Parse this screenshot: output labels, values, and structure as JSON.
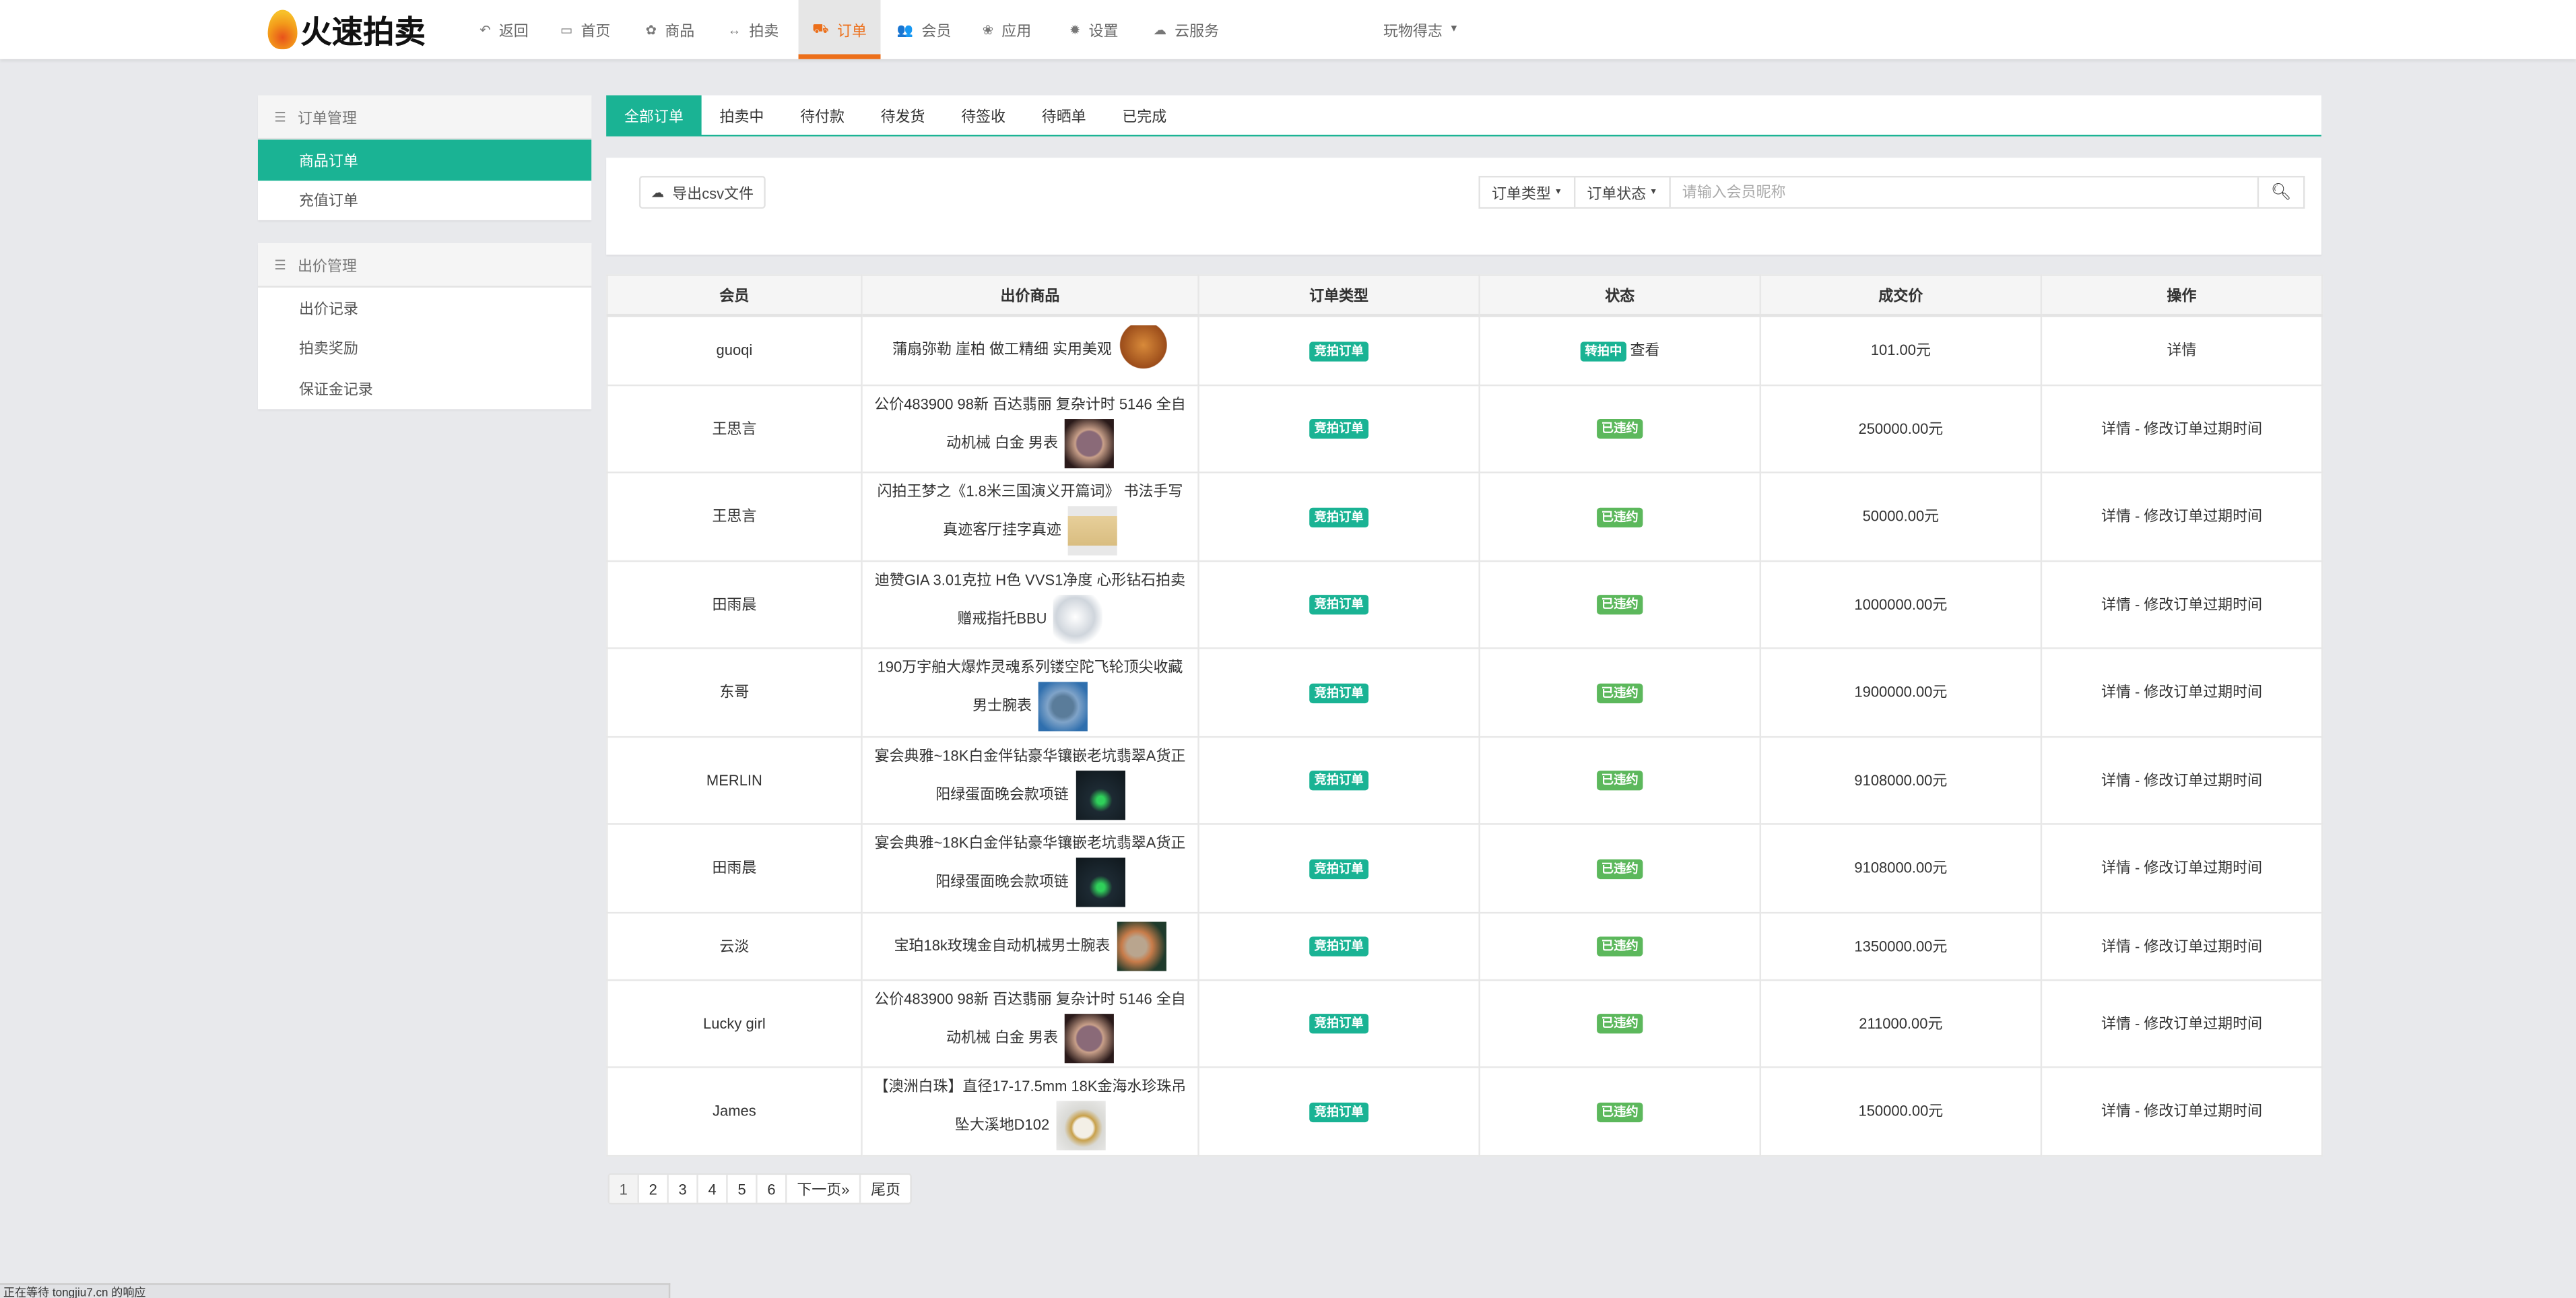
{
  "header": {
    "logo_text": "火速拍卖",
    "nav": [
      {
        "label": "返回",
        "icon": "reply-icon"
      },
      {
        "label": "首页",
        "icon": "desktop-icon"
      },
      {
        "label": "商品",
        "icon": "gift-icon"
      },
      {
        "label": "拍卖",
        "icon": "arrows-h-icon"
      },
      {
        "label": "订单",
        "icon": "cart-icon",
        "active": true
      },
      {
        "label": "会员",
        "icon": "users-icon"
      },
      {
        "label": "应用",
        "icon": "apps-icon"
      },
      {
        "label": "设置",
        "icon": "gear-icon"
      },
      {
        "label": "云服务",
        "icon": "cloud-icon"
      }
    ],
    "user": "玩物得志"
  },
  "sidebar": [
    {
      "title": "订单管理",
      "items": [
        {
          "label": "商品订单",
          "active": true
        },
        {
          "label": "充值订单"
        }
      ]
    },
    {
      "title": "出价管理",
      "items": [
        {
          "label": "出价记录"
        },
        {
          "label": "拍卖奖励"
        },
        {
          "label": "保证金记录"
        }
      ]
    }
  ],
  "tabs": [
    "全部订单",
    "拍卖中",
    "待付款",
    "待发货",
    "待签收",
    "待晒单",
    "已完成"
  ],
  "toolbar": {
    "export": "导出csv文件",
    "order_type": "订单类型",
    "order_status": "订单状态",
    "search_placeholder": "请输入会员昵称"
  },
  "table": {
    "headers": [
      "会员",
      "出价商品",
      "订单类型",
      "状态",
      "成交价",
      "操作"
    ],
    "rows": [
      {
        "member": "guoqi",
        "product": "蒲扇弥勒 崖柏 做工精细 实用美观",
        "type": "竞拍订单",
        "status": "转拍中",
        "status_link": "查看",
        "price": "101.00元",
        "actions": "详情"
      },
      {
        "member": "王思言",
        "product": "公价483900 98新 百达翡丽 复杂计时 5146 全自动机械 白金 男表",
        "type": "竞拍订单",
        "status": "已违约",
        "price": "250000.00元",
        "actions": "详情 - 修改订单过期时间"
      },
      {
        "member": "王思言",
        "product": "闪拍王梦之《1.8米三国演义开篇词》 书法手写真迹客厅挂字真迹",
        "type": "竞拍订单",
        "status": "已违约",
        "price": "50000.00元",
        "actions": "详情 - 修改订单过期时间"
      },
      {
        "member": "田雨晨",
        "product": "迪赞GIA 3.01克拉 H色 VVS1净度 心形钻石拍卖赠戒指托BBU",
        "type": "竞拍订单",
        "status": "已违约",
        "price": "1000000.00元",
        "actions": "详情 - 修改订单过期时间"
      },
      {
        "member": "东哥",
        "product": "190万宇舶大爆炸灵魂系列镂空陀飞轮顶尖收藏男士腕表",
        "type": "竞拍订单",
        "status": "已违约",
        "price": "1900000.00元",
        "actions": "详情 - 修改订单过期时间"
      },
      {
        "member": "MERLIN",
        "product": "宴会典雅~18K白金伴钻豪华镶嵌老坑翡翠A货正阳绿蛋面晚会款项链",
        "type": "竞拍订单",
        "status": "已违约",
        "price": "9108000.00元",
        "actions": "详情 - 修改订单过期时间"
      },
      {
        "member": "田雨晨",
        "product": "宴会典雅~18K白金伴钻豪华镶嵌老坑翡翠A货正阳绿蛋面晚会款项链",
        "type": "竞拍订单",
        "status": "已违约",
        "price": "9108000.00元",
        "actions": "详情 - 修改订单过期时间"
      },
      {
        "member": "云淡",
        "product": "宝珀18k玫瑰金自动机械男士腕表",
        "type": "竞拍订单",
        "status": "已违约",
        "price": "1350000.00元",
        "actions": "详情 - 修改订单过期时间"
      },
      {
        "member": "Lucky girl",
        "product": "公价483900 98新 百达翡丽 复杂计时 5146 全自动机械 白金 男表",
        "type": "竞拍订单",
        "status": "已违约",
        "price": "211000.00元",
        "actions": "详情 - 修改订单过期时间"
      },
      {
        "member": "James",
        "product": "【澳洲白珠】直径17-17.5mm 18K金海水珍珠吊坠大溪地D102",
        "type": "竞拍订单",
        "status": "已违约",
        "price": "150000.00元",
        "actions": "详情 - 修改订单过期时间"
      }
    ]
  },
  "pagination": [
    "1",
    "2",
    "3",
    "4",
    "5",
    "6",
    "下一页»",
    "尾页"
  ],
  "statusbar": "正在等待 tongjiu7.cn 的响应",
  "colors": {
    "accent": "#1ab394",
    "nav_active": "#ec6f1a",
    "badge_default": "#5cb85c"
  }
}
